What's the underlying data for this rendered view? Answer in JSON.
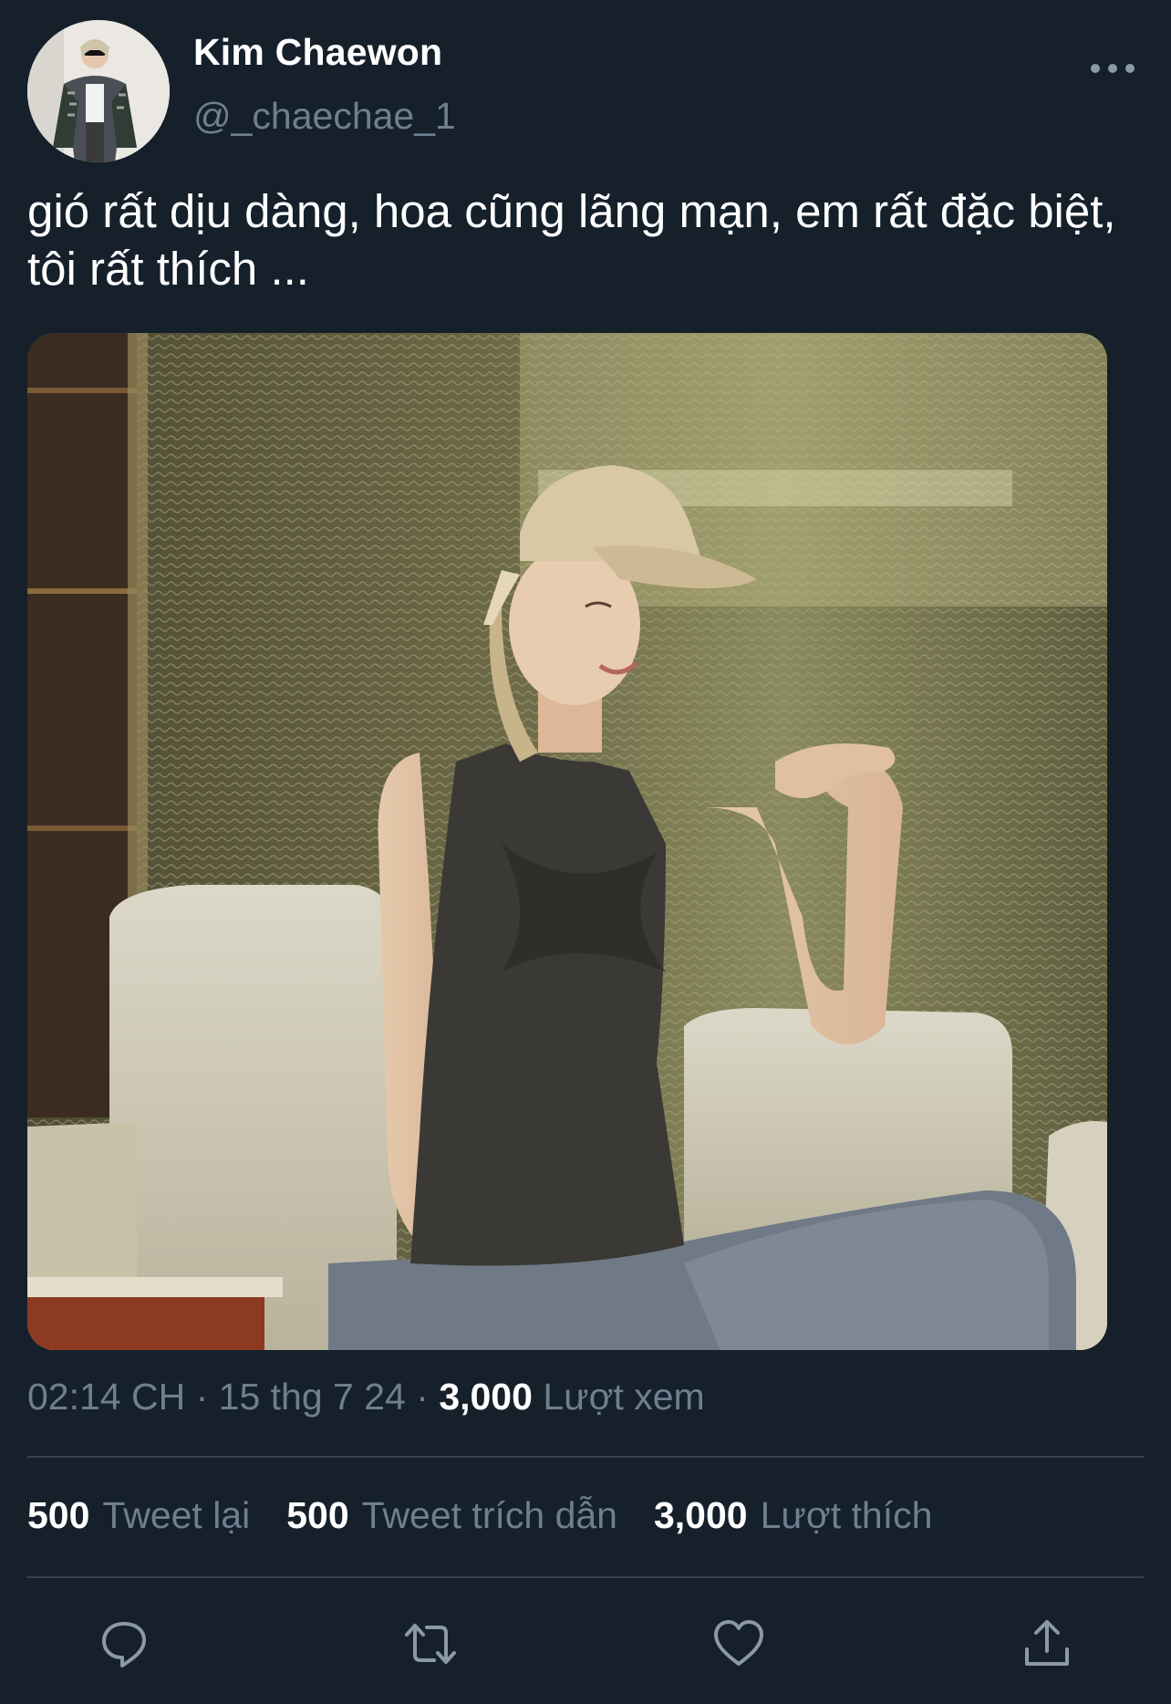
{
  "author": {
    "display_name": "Kim Chaewon",
    "handle": "@_chaechae_1",
    "avatar_icon": "profile-photo"
  },
  "tweet": {
    "text": "gió rất dịu dàng, hoa cũng lãng mạn, em rất đặc biệt, tôi rất thích ...",
    "time": "02:14 CH",
    "date": "15 thg 7 24",
    "views_count": "3,000",
    "views_label": "Lượt xem"
  },
  "stats": {
    "retweets_count": "500",
    "retweets_label": "Tweet lại",
    "quotes_count": "500",
    "quotes_label": "Tweet trích dẫn",
    "likes_count": "3,000",
    "likes_label": "Lượt thích"
  },
  "icons": {
    "more": "more-icon",
    "reply": "reply-icon",
    "retweet": "retweet-icon",
    "like": "heart-icon",
    "share": "share-icon"
  },
  "colors": {
    "background": "#15202b",
    "secondary_text": "#6e7f8f",
    "divider": "#38444d"
  }
}
